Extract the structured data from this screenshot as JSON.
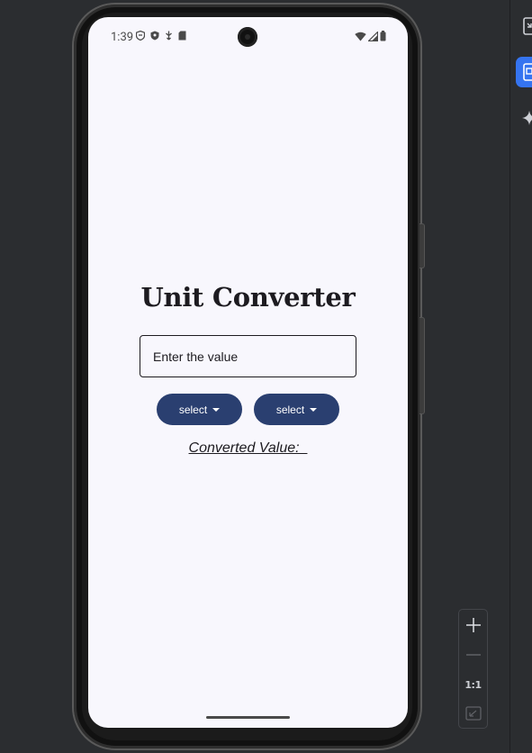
{
  "status_bar": {
    "time": "1:39",
    "left_icons": [
      "shield-icon",
      "vpn-key-icon",
      "usb-icon",
      "sd-card-icon"
    ],
    "right_icons": [
      "wifi-icon",
      "signal-icon",
      "battery-icon"
    ]
  },
  "app": {
    "title": "Unit Converter",
    "input": {
      "placeholder": "Enter the value",
      "value": ""
    },
    "from_unit_label": "select",
    "to_unit_label": "select",
    "result_text": "Converted Value:  "
  },
  "zoom_controls": {
    "zoom_in_icon": "plus-icon",
    "zoom_out_icon": "minus-icon",
    "actual_size_label": "1:1",
    "fit_screen_icon": "fit-screen-icon"
  },
  "toolbar": {
    "icons": [
      "device-mirror-icon",
      "running-devices-icon",
      "gemini-sparkle-icon"
    ],
    "active_index": 1
  },
  "colors": {
    "ide_background": "#2b2d30",
    "screen_background": "#f8f7fd",
    "button_fill": "#2a3f70",
    "button_text": "#ffffff",
    "text_primary": "#1d1b20",
    "toolbar_active": "#3574f0"
  }
}
